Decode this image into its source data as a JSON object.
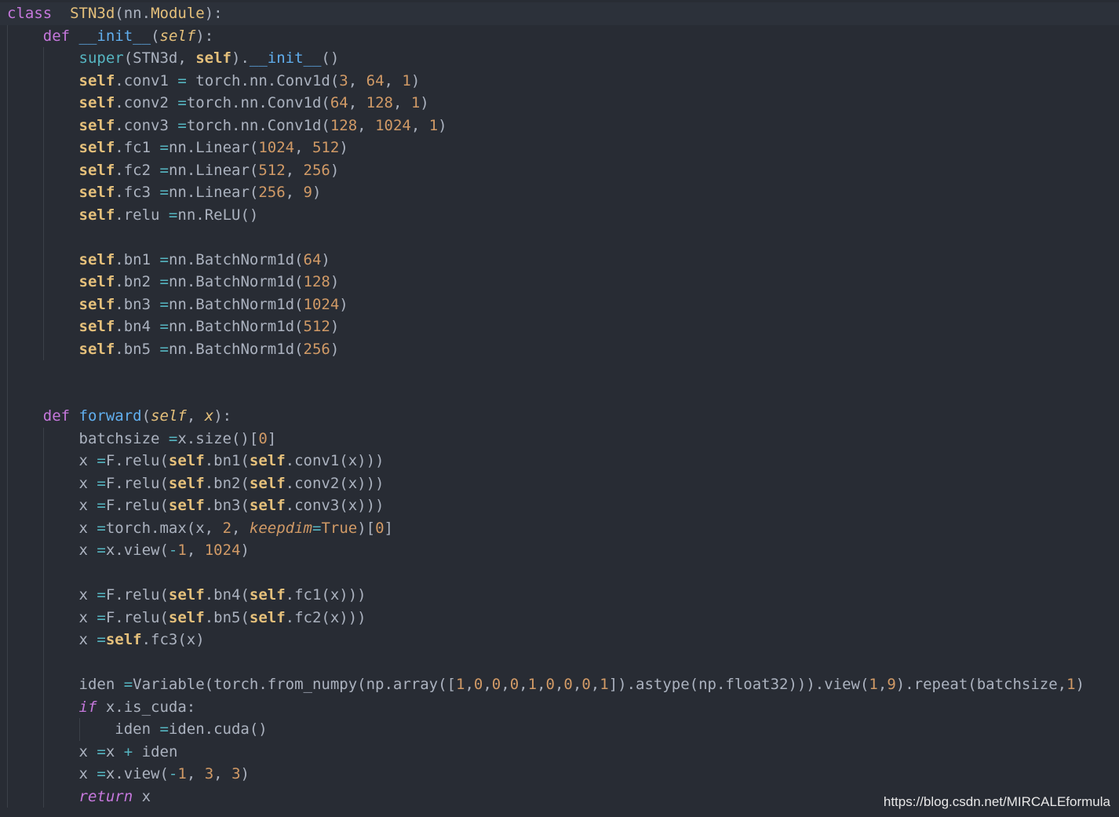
{
  "editor": {
    "theme_colors": {
      "background": "#282c34",
      "keyword": "#c678dd",
      "function": "#61afef",
      "class_self": "#e5c07b",
      "number": "#d19a66",
      "operator": "#56b6c2",
      "text": "#abb2bf"
    },
    "lines": [
      [
        [
          "kw",
          "class"
        ],
        [
          "",
          "  "
        ],
        [
          "cls",
          "STN3d"
        ],
        [
          "",
          "(nn."
        ],
        [
          "cls",
          "Module"
        ],
        [
          "",
          "):"
        ]
      ],
      [
        [
          "",
          "    "
        ],
        [
          "kw",
          "def"
        ],
        [
          "",
          ""
        ],
        [
          "fn",
          "__init__"
        ],
        [
          "",
          "("
        ],
        [
          "param",
          "self"
        ],
        [
          "",
          "):"
        ]
      ],
      [
        [
          "",
          "        "
        ],
        [
          "builtin",
          "super"
        ],
        [
          "",
          "(STN3d, "
        ],
        [
          "self",
          "self"
        ],
        [
          "",
          ")."
        ],
        [
          "fn",
          "__init__"
        ],
        [
          "",
          "()"
        ]
      ],
      [
        [
          "",
          "        "
        ],
        [
          "self",
          "self"
        ],
        [
          "",
          ".conv1 "
        ],
        [
          "op",
          "="
        ],
        [
          "",
          ""
        ],
        [
          "",
          "torch.nn.Conv1d("
        ],
        [
          "num",
          "3"
        ],
        [
          "",
          ", "
        ],
        [
          "num",
          "64"
        ],
        [
          "",
          ", "
        ],
        [
          "num",
          "1"
        ],
        [
          "",
          ")"
        ]
      ],
      [
        [
          "",
          "        "
        ],
        [
          "self",
          "self"
        ],
        [
          "",
          ".conv2 "
        ],
        [
          "op",
          "="
        ],
        [
          "",
          "torch.nn.Conv1d("
        ],
        [
          "num",
          "64"
        ],
        [
          "",
          ", "
        ],
        [
          "num",
          "128"
        ],
        [
          "",
          ", "
        ],
        [
          "num",
          "1"
        ],
        [
          "",
          ")"
        ]
      ],
      [
        [
          "",
          "        "
        ],
        [
          "self",
          "self"
        ],
        [
          "",
          ".conv3 "
        ],
        [
          "op",
          "="
        ],
        [
          "",
          "torch.nn.Conv1d("
        ],
        [
          "num",
          "128"
        ],
        [
          "",
          ", "
        ],
        [
          "num",
          "1024"
        ],
        [
          "",
          ", "
        ],
        [
          "num",
          "1"
        ],
        [
          "",
          ")"
        ]
      ],
      [
        [
          "",
          "        "
        ],
        [
          "self",
          "self"
        ],
        [
          "",
          ".fc1 "
        ],
        [
          "op",
          "="
        ],
        [
          "",
          "nn.Linear("
        ],
        [
          "num",
          "1024"
        ],
        [
          "",
          ", "
        ],
        [
          "num",
          "512"
        ],
        [
          "",
          ")"
        ]
      ],
      [
        [
          "",
          "        "
        ],
        [
          "self",
          "self"
        ],
        [
          "",
          ".fc2 "
        ],
        [
          "op",
          "="
        ],
        [
          "",
          "nn.Linear("
        ],
        [
          "num",
          "512"
        ],
        [
          "",
          ", "
        ],
        [
          "num",
          "256"
        ],
        [
          "",
          ")"
        ]
      ],
      [
        [
          "",
          "        "
        ],
        [
          "self",
          "self"
        ],
        [
          "",
          ".fc3 "
        ],
        [
          "op",
          "="
        ],
        [
          "",
          "nn.Linear("
        ],
        [
          "num",
          "256"
        ],
        [
          "",
          ", "
        ],
        [
          "num",
          "9"
        ],
        [
          "",
          ")"
        ]
      ],
      [
        [
          "",
          "        "
        ],
        [
          "self",
          "self"
        ],
        [
          "",
          ".relu "
        ],
        [
          "op",
          "="
        ],
        [
          "",
          "nn.ReLU()"
        ]
      ],
      [],
      [
        [
          "",
          "        "
        ],
        [
          "self",
          "self"
        ],
        [
          "",
          ".bn1 "
        ],
        [
          "op",
          "="
        ],
        [
          "",
          "nn.BatchNorm1d("
        ],
        [
          "num",
          "64"
        ],
        [
          "",
          ")"
        ]
      ],
      [
        [
          "",
          "        "
        ],
        [
          "self",
          "self"
        ],
        [
          "",
          ".bn2 "
        ],
        [
          "op",
          "="
        ],
        [
          "",
          "nn.BatchNorm1d("
        ],
        [
          "num",
          "128"
        ],
        [
          "",
          ")"
        ]
      ],
      [
        [
          "",
          "        "
        ],
        [
          "self",
          "self"
        ],
        [
          "",
          ".bn3 "
        ],
        [
          "op",
          "="
        ],
        [
          "",
          "nn.BatchNorm1d("
        ],
        [
          "num",
          "1024"
        ],
        [
          "",
          ")"
        ]
      ],
      [
        [
          "",
          "        "
        ],
        [
          "self",
          "self"
        ],
        [
          "",
          ".bn4 "
        ],
        [
          "op",
          "="
        ],
        [
          "",
          "nn.BatchNorm1d("
        ],
        [
          "num",
          "512"
        ],
        [
          "",
          ")"
        ]
      ],
      [
        [
          "",
          "        "
        ],
        [
          "self",
          "self"
        ],
        [
          "",
          ".bn5 "
        ],
        [
          "op",
          "="
        ],
        [
          "",
          "nn.BatchNorm1d("
        ],
        [
          "num",
          "256"
        ],
        [
          "",
          ")"
        ]
      ],
      [],
      [],
      [
        [
          "",
          "    "
        ],
        [
          "kw",
          "def"
        ],
        [
          "",
          ""
        ],
        [
          "fn",
          "forward"
        ],
        [
          "",
          "("
        ],
        [
          "param",
          "self"
        ],
        [
          "",
          ", "
        ],
        [
          "param",
          "x"
        ],
        [
          "",
          "):"
        ]
      ],
      [
        [
          "",
          "        batchsize "
        ],
        [
          "op",
          "="
        ],
        [
          "",
          "x.size()["
        ],
        [
          "num",
          "0"
        ],
        [
          "",
          "]"
        ]
      ],
      [
        [
          "",
          "        x "
        ],
        [
          "op",
          "="
        ],
        [
          "",
          "F.relu("
        ],
        [
          "self",
          "self"
        ],
        [
          "",
          ".bn1("
        ],
        [
          "self",
          "self"
        ],
        [
          "",
          ".conv1(x)))"
        ]
      ],
      [
        [
          "",
          "        x "
        ],
        [
          "op",
          "="
        ],
        [
          "",
          "F.relu("
        ],
        [
          "self",
          "self"
        ],
        [
          "",
          ".bn2("
        ],
        [
          "self",
          "self"
        ],
        [
          "",
          ".conv2(x)))"
        ]
      ],
      [
        [
          "",
          "        x "
        ],
        [
          "op",
          "="
        ],
        [
          "",
          "F.relu("
        ],
        [
          "self",
          "self"
        ],
        [
          "",
          ".bn3("
        ],
        [
          "self",
          "self"
        ],
        [
          "",
          ".conv3(x)))"
        ]
      ],
      [
        [
          "",
          "        x "
        ],
        [
          "op",
          "="
        ],
        [
          "",
          "torch.max(x, "
        ],
        [
          "num",
          "2"
        ],
        [
          "",
          ", "
        ],
        [
          "kwarg",
          "keepdim"
        ],
        [
          "op",
          "="
        ],
        [
          "bool",
          "True"
        ],
        [
          "",
          ")["
        ],
        [
          "num",
          "0"
        ],
        [
          "",
          "]"
        ]
      ],
      [
        [
          "",
          "        x "
        ],
        [
          "op",
          "="
        ],
        [
          "",
          "x.view("
        ],
        [
          "op",
          "-"
        ],
        [
          "num",
          "1"
        ],
        [
          "",
          ", "
        ],
        [
          "num",
          "1024"
        ],
        [
          "",
          ")"
        ]
      ],
      [],
      [
        [
          "",
          "        x "
        ],
        [
          "op",
          "="
        ],
        [
          "",
          "F.relu("
        ],
        [
          "self",
          "self"
        ],
        [
          "",
          ".bn4("
        ],
        [
          "self",
          "self"
        ],
        [
          "",
          ".fc1(x)))"
        ]
      ],
      [
        [
          "",
          "        x "
        ],
        [
          "op",
          "="
        ],
        [
          "",
          "F.relu("
        ],
        [
          "self",
          "self"
        ],
        [
          "",
          ".bn5("
        ],
        [
          "self",
          "self"
        ],
        [
          "",
          ".fc2(x)))"
        ]
      ],
      [
        [
          "",
          "        x "
        ],
        [
          "op",
          "="
        ],
        [
          "self",
          "self"
        ],
        [
          "",
          ".fc3(x)"
        ]
      ],
      [],
      [
        [
          "",
          "        iden "
        ],
        [
          "op",
          "="
        ],
        [
          "",
          "Variable(torch.from_numpy(np.array(["
        ],
        [
          "num",
          "1"
        ],
        [
          "",
          ","
        ],
        [
          "num",
          "0"
        ],
        [
          "",
          ","
        ],
        [
          "num",
          "0"
        ],
        [
          "",
          ","
        ],
        [
          "num",
          "0"
        ],
        [
          "",
          ","
        ],
        [
          "num",
          "1"
        ],
        [
          "",
          ","
        ],
        [
          "num",
          "0"
        ],
        [
          "",
          ","
        ],
        [
          "num",
          "0"
        ],
        [
          "",
          ","
        ],
        [
          "num",
          "0"
        ],
        [
          "",
          ","
        ],
        [
          "num",
          "1"
        ],
        [
          "",
          "]).astype(np.float32))).view("
        ],
        [
          "num",
          "1"
        ],
        [
          "",
          ","
        ],
        [
          "num",
          "9"
        ],
        [
          "",
          ").repeat(batchsize,"
        ],
        [
          "num",
          "1"
        ],
        [
          "",
          ")"
        ]
      ],
      [
        [
          "",
          "        "
        ],
        [
          "kw ital",
          "if"
        ],
        [
          "",
          ""
        ],
        [
          "",
          "x.is_cuda:"
        ]
      ],
      [
        [
          "",
          "            iden "
        ],
        [
          "op",
          "="
        ],
        [
          "",
          "iden.cuda()"
        ]
      ],
      [
        [
          "",
          "        x "
        ],
        [
          "op",
          "="
        ],
        [
          "",
          "x "
        ],
        [
          "op",
          "+"
        ],
        [
          "",
          ""
        ],
        [
          "",
          "iden"
        ]
      ],
      [
        [
          "",
          "        x "
        ],
        [
          "op",
          "="
        ],
        [
          "",
          "x.view("
        ],
        [
          "op",
          "-"
        ],
        [
          "num",
          "1"
        ],
        [
          "",
          ", "
        ],
        [
          "num",
          "3"
        ],
        [
          "",
          ", "
        ],
        [
          "num",
          "3"
        ],
        [
          "",
          ")"
        ]
      ],
      [
        [
          "",
          "        "
        ],
        [
          "kw ital",
          "return"
        ],
        [
          "",
          ""
        ],
        [
          "",
          "x"
        ]
      ]
    ]
  },
  "watermark": {
    "text": "https://blog.csdn.net/MIRCALEformula"
  }
}
